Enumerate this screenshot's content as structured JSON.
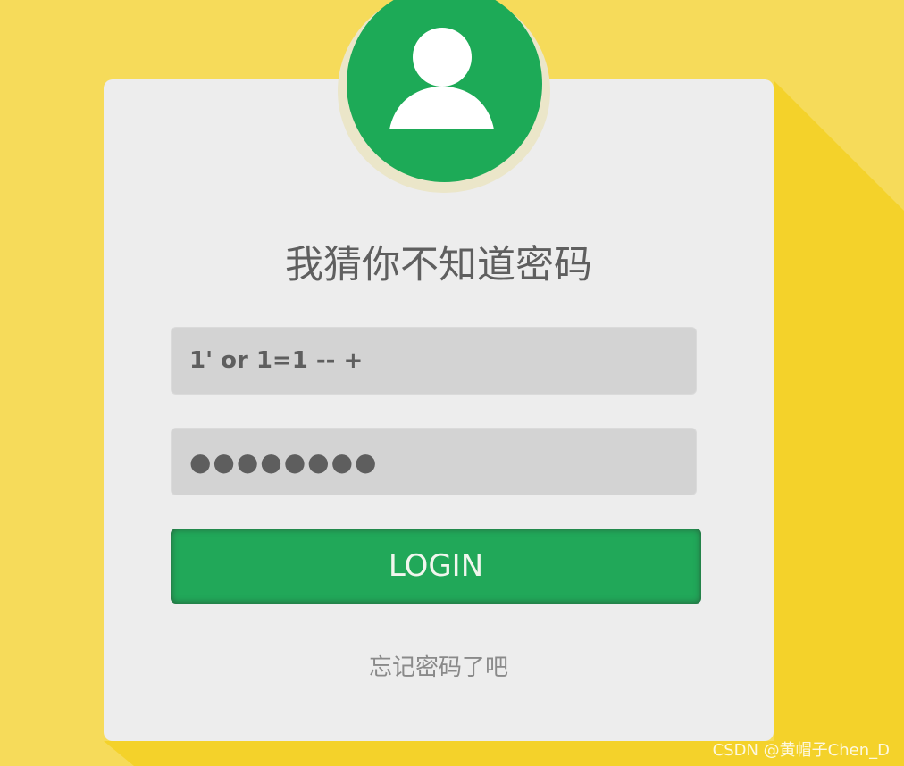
{
  "login_form": {
    "title": "我猜你不知道密码",
    "username_value": "1' or 1=1 -- +",
    "password_value": "●●●●●●●●",
    "login_label": "LOGIN",
    "forgot_label": "忘记密码了吧"
  },
  "avatar": {
    "icon": "user-icon"
  },
  "watermark": "CSDN @黄帽子Chen_D",
  "colors": {
    "background": "#F6DB5A",
    "background_shadow": "#F4D22A",
    "card": "#EDEDED",
    "accent_green": "#1DAA57",
    "field": "#D3D3D3"
  }
}
